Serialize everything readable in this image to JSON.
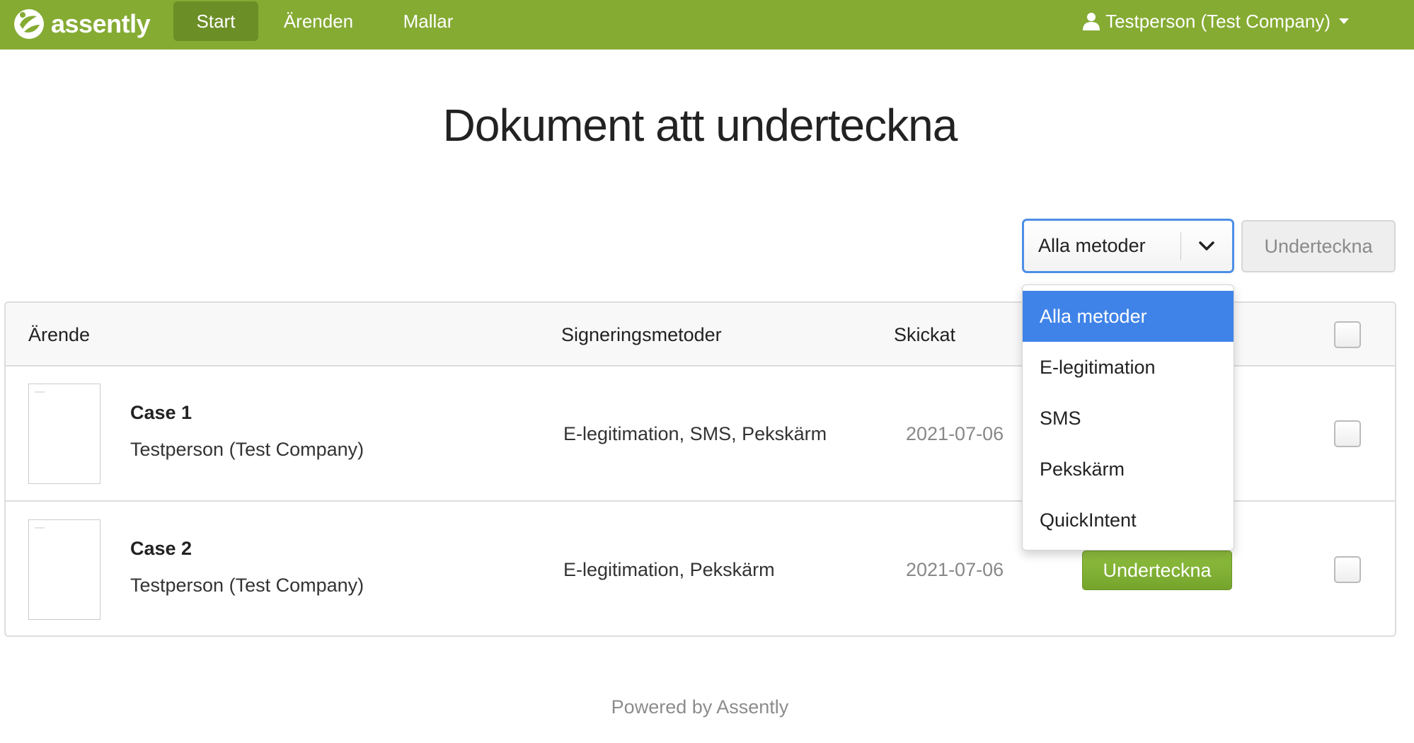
{
  "colors": {
    "navbar_bg": "#85ab33",
    "nav_active_bg": "#6c8e26",
    "select_focus_border": "#4d8fe6",
    "dropdown_selected_bg": "#3f83e8",
    "sign_button_bg": "#7fae32"
  },
  "navbar": {
    "brand": "assently",
    "brand_icon": "assently-logo-icon",
    "items": [
      {
        "label": "Start",
        "active": true
      },
      {
        "label": "Ärenden",
        "active": false
      },
      {
        "label": "Mallar",
        "active": false
      }
    ],
    "user": {
      "icon": "user-icon",
      "label": "Testperson (Test Company)",
      "caret_icon": "caret-down-icon"
    }
  },
  "page": {
    "title": "Dokument att underteckna"
  },
  "toolbar": {
    "method_select": {
      "value": "Alla metoder",
      "chevron_icon": "chevron-down-icon",
      "options": [
        "Alla metoder",
        "E-legitimation",
        "SMS",
        "Pekskärm",
        "QuickIntent"
      ],
      "open": true
    },
    "sign_all_label": "Underteckna"
  },
  "table": {
    "columns": {
      "case": "Ärende",
      "methods": "Signeringsmetoder",
      "sent": "Skickat"
    },
    "rows": [
      {
        "name": "Case 1",
        "owner": "Testperson (Test Company)",
        "methods": "E-legitimation, SMS, Pekskärm",
        "sent": "2021-07-06"
      },
      {
        "name": "Case 2",
        "owner": "Testperson (Test Company)",
        "methods": "E-legitimation, Pekskärm",
        "sent": "2021-07-06",
        "sign_label": "Underteckna"
      }
    ]
  },
  "footer": {
    "text": "Powered by Assently"
  }
}
